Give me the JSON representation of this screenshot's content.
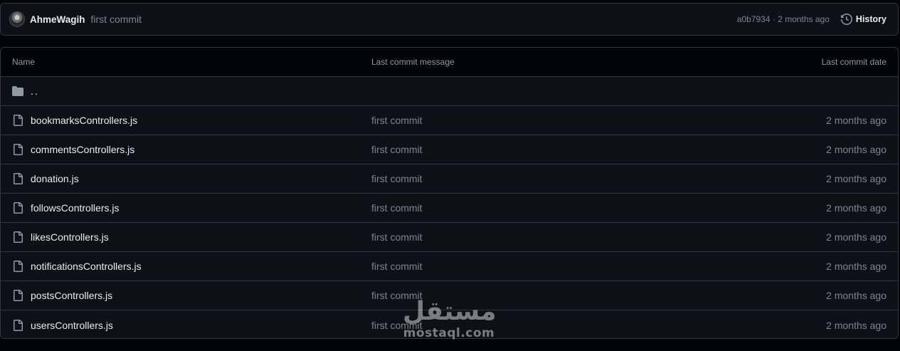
{
  "latest_commit": {
    "author": "AhmeWagih",
    "message": "first commit",
    "hash_and_time": "a0b7934 · 2 months ago",
    "history_label": "History"
  },
  "table": {
    "headers": {
      "name": "Name",
      "message": "Last commit message",
      "date": "Last commit date"
    },
    "parent_dir": "..",
    "rows": [
      {
        "name": "bookmarksControllers.js",
        "message": "first commit",
        "date": "2 months ago"
      },
      {
        "name": "commentsControllers.js",
        "message": "first commit",
        "date": "2 months ago"
      },
      {
        "name": "donation.js",
        "message": "first commit",
        "date": "2 months ago"
      },
      {
        "name": "followsControllers.js",
        "message": "first commit",
        "date": "2 months ago"
      },
      {
        "name": "likesControllers.js",
        "message": "first commit",
        "date": "2 months ago"
      },
      {
        "name": "notificationsControllers.js",
        "message": "first commit",
        "date": "2 months ago"
      },
      {
        "name": "postsControllers.js",
        "message": "first commit",
        "date": "2 months ago"
      },
      {
        "name": "usersControllers.js",
        "message": "first commit",
        "date": "2 months ago"
      }
    ]
  },
  "watermark": {
    "arabic": "مستقل",
    "latin": "mostaql.com"
  },
  "colors": {
    "page_bg": "#010409",
    "panel_bg": "#0d1117",
    "border": "#30363d",
    "text": "#e6edf3",
    "muted": "#7d8590"
  },
  "icons": {
    "history": "history-icon",
    "folder": "folder-icon",
    "file": "file-icon"
  }
}
